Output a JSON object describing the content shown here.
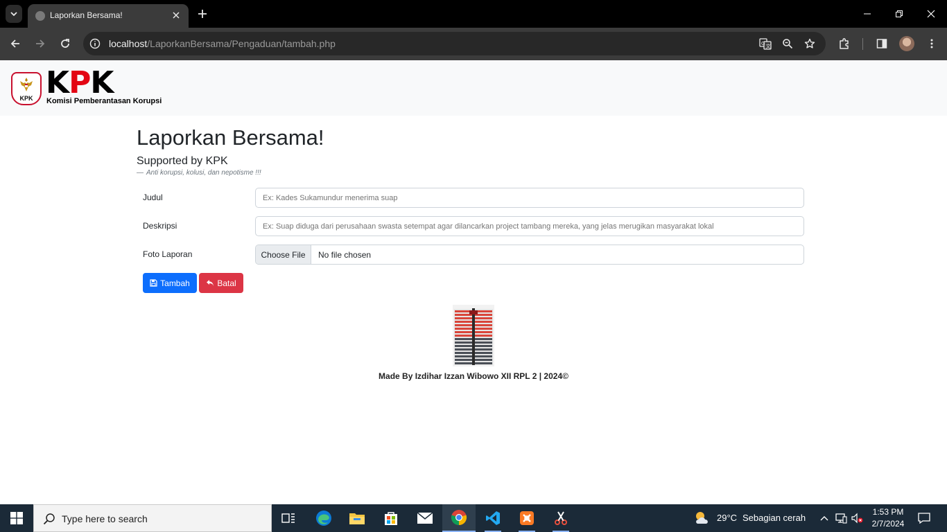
{
  "browser": {
    "tab_title": "Laporkan Bersama!",
    "url_host": "localhost",
    "url_path": "/LaporkanBersama/Pengaduan/tambah.php"
  },
  "navbar": {
    "logo_word_k": "K",
    "logo_word_p": "P",
    "logo_word_k2": "K",
    "logo_subtitle": "Komisi Pemberantasan Korupsi",
    "emblem_text": "KPK"
  },
  "main": {
    "title": "Laporkan Bersama!",
    "lead": "Supported by KPK",
    "quote_dash": "—",
    "quote": "Anti korupsi, kolusi, dan nepotisme !!!"
  },
  "form": {
    "judul_label": "Judul",
    "judul_placeholder": "Ex: Kades Sukamundur menerima suap",
    "deskripsi_label": "Deskripsi",
    "deskripsi_placeholder": "Ex: Suap diduga dari perusahaan swasta setempat agar dilancarkan project tambang mereka, yang jelas merugikan masyarakat lokal",
    "foto_label": "Foto Laporan",
    "file_button": "Choose File",
    "file_status": "No file chosen",
    "submit_label": "Tambah",
    "cancel_label": "Batal"
  },
  "footer": {
    "text": "Made By Izdihar Izzan Wibowo XII RPL 2 | 2024©"
  },
  "taskbar": {
    "search_placeholder": "Type here to search",
    "weather_temp": "29°C",
    "weather_desc": "Sebagian cerah",
    "time": "1:53 PM",
    "date": "2/7/2024"
  },
  "colors": {
    "primary": "#0d6efd",
    "danger": "#dc3545",
    "kpk_red": "#e30613"
  }
}
